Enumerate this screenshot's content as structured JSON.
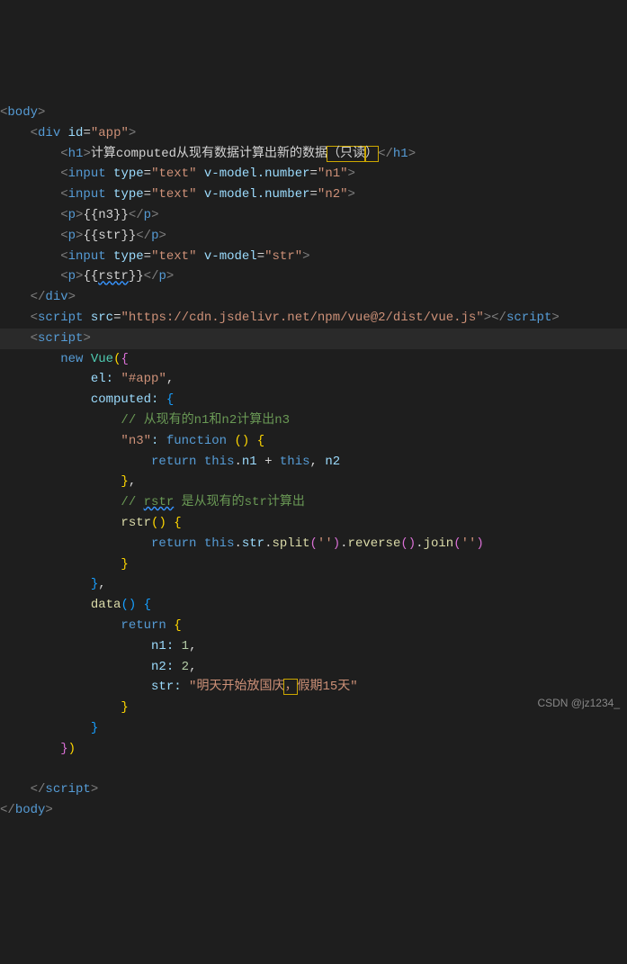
{
  "code": {
    "l1_body": "body",
    "l2_div": "div",
    "l2_id": "id",
    "l2_app": "\"app\"",
    "l3_h1": "h1",
    "l3_txt1": "计算computed从现有数据计算出新的数据",
    "l3_warn1": "（只读",
    "l3_warn2": "）",
    "l4_input": "input",
    "l4_type": "type",
    "l4_text": "\"text\"",
    "l4_vm": "v-model.number",
    "l4_n1": "\"n1\"",
    "l5_n2": "\"n2\"",
    "l6_p": "p",
    "l6_n3": "{{n3}}",
    "l7_str": "{{str}}",
    "l8_vm": "v-model",
    "l8_strv": "\"str\"",
    "l9_rstr": "{{",
    "l9_rstr2": "rstr",
    "l9_rstr3": "}}",
    "l10_divc": "div",
    "l11_script": "script",
    "l11_src": "src",
    "l11_url": "\"https://cdn.jsdelivr.net/npm/vue@2/dist/vue.js\"",
    "l12_script": "script",
    "l13_new": "new",
    "l13_vue": "Vue",
    "l14_el": "el:",
    "l14_app": "\"#app\"",
    "l15_computed": "computed:",
    "l16_c1": "// 从现有的n1和n2计算出n3",
    "l17_n3": "\"n3\"",
    "l17_fn": "function",
    "l18_ret": "return",
    "l18_this": "this",
    "l18_n1": "n1",
    "l18_plus": "+",
    "l18_n2": "n2",
    "l20_c2a": "// ",
    "l20_c2b": "rstr",
    "l20_c2c": " 是从现有的str计算出",
    "l21_rstr": "rstr",
    "l22_ret": "return",
    "l22_this": "this",
    "l22_str": "str",
    "l22_split": "split",
    "l22_rev": "reverse",
    "l22_join": "join",
    "l22_e": "''",
    "l25_data": "data",
    "l26_ret": "return",
    "l27_n1": "n1:",
    "l27_v1": "1",
    "l28_n2": "n2:",
    "l28_v2": "2",
    "l29_str": "str:",
    "l29_v1": "\"明天开始放国庆",
    "l29_warn": "，",
    "l29_v2": "假期15天\"",
    "l34_script": "script",
    "l35_body": "body"
  },
  "watermark": "CSDN @jz1234_"
}
